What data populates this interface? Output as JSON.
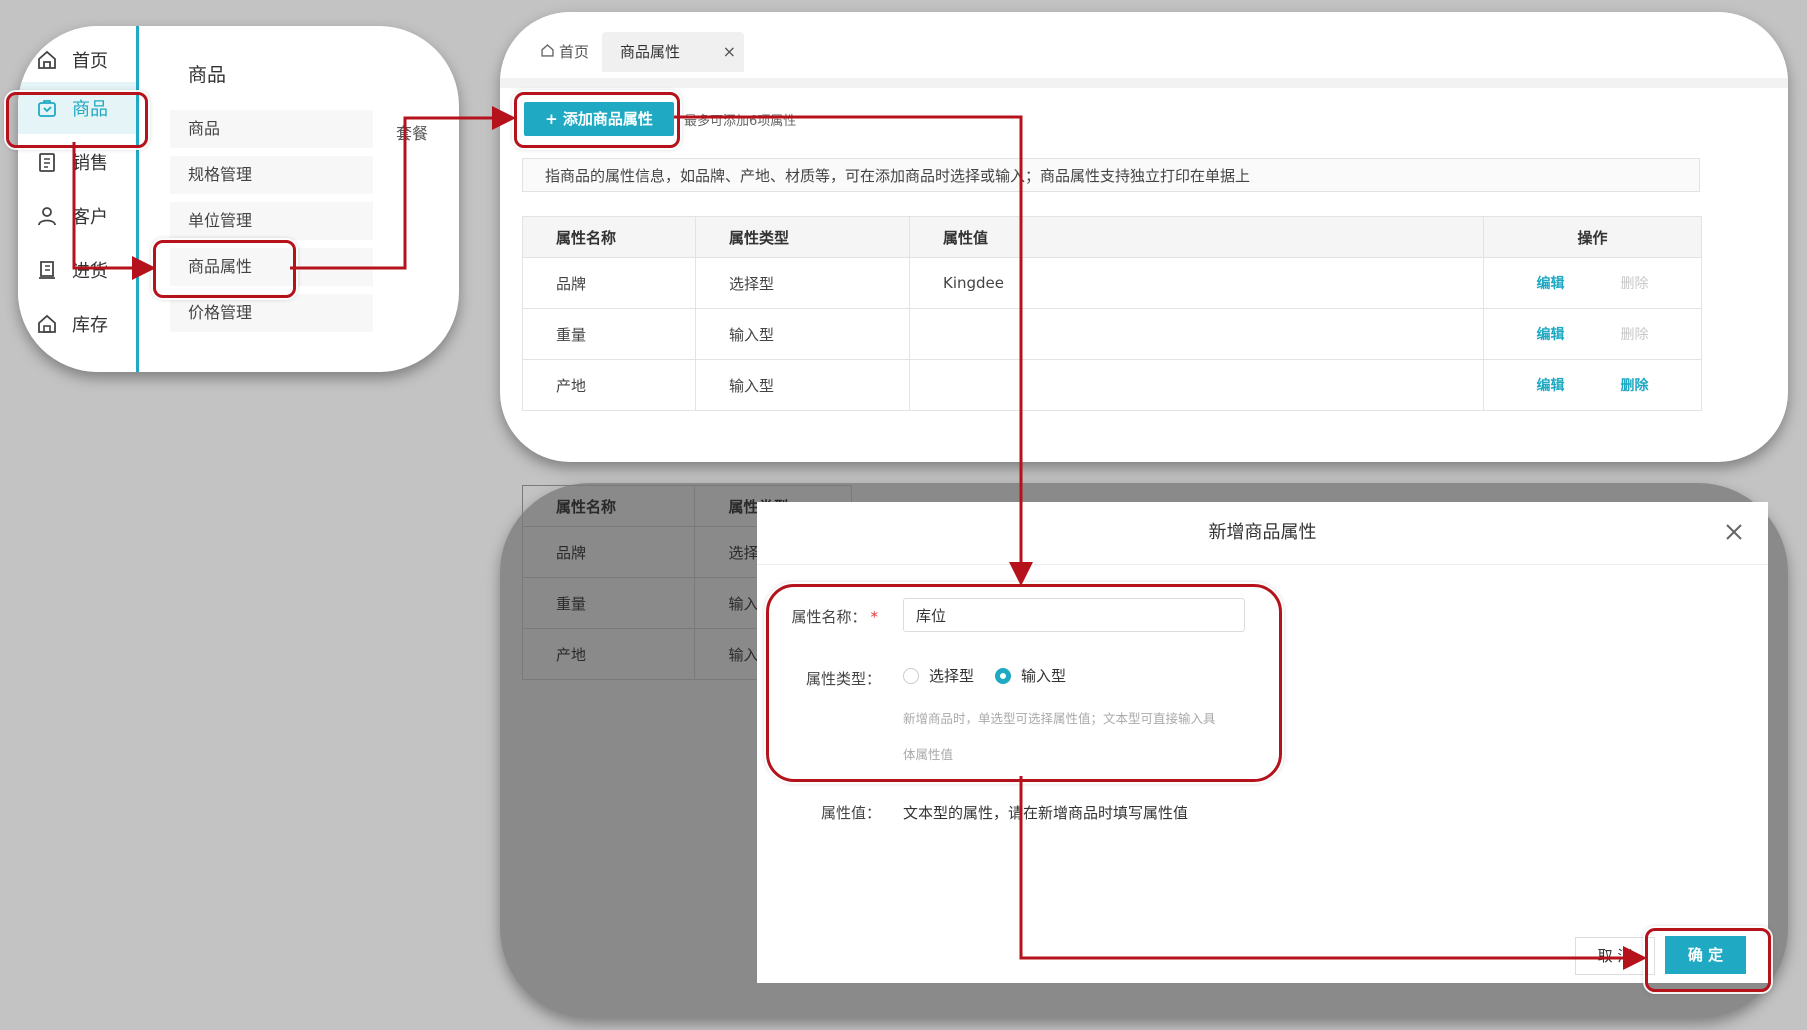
{
  "sidebar": {
    "items": [
      {
        "label": "首页",
        "icon": "home-icon"
      },
      {
        "label": "商品",
        "icon": "goods-icon",
        "active": true
      },
      {
        "label": "销售",
        "icon": "sales-icon"
      },
      {
        "label": "客户",
        "icon": "customer-icon"
      },
      {
        "label": "进货",
        "icon": "purchase-icon"
      },
      {
        "label": "库存",
        "icon": "inventory-icon"
      }
    ]
  },
  "submenu": {
    "title": "商品",
    "items": [
      "商品",
      "规格管理",
      "单位管理",
      "商品属性",
      "价格管理"
    ],
    "extra": "套餐"
  },
  "tabs": {
    "home": "首页",
    "active": "商品属性"
  },
  "toolbar": {
    "add_label": "+ 添加商品属性",
    "limit_text": "最多可添加6项属性"
  },
  "notice": "指商品的属性信息，如品牌、产地、材质等，可在添加商品时选择或输入；商品属性支持独立打印在单据上",
  "table": {
    "headers": [
      "属性名称",
      "属性类型",
      "属性值",
      "操作"
    ],
    "rows": [
      {
        "name": "品牌",
        "type": "选择型",
        "value": "Kingdee",
        "edit": "编辑",
        "delete": "删除",
        "delete_enabled": false
      },
      {
        "name": "重量",
        "type": "输入型",
        "value": "",
        "edit": "编辑",
        "delete": "删除",
        "delete_enabled": false
      },
      {
        "name": "产地",
        "type": "输入型",
        "value": "",
        "edit": "编辑",
        "delete": "删除",
        "delete_enabled": true
      }
    ]
  },
  "dialog": {
    "title": "新增商品属性",
    "name_label": "属性名称：",
    "name_value": "库位",
    "type_label": "属性类型：",
    "type_options": [
      "选择型",
      "输入型"
    ],
    "type_selected": "输入型",
    "hint_line1": "新增商品时，单选型可选择属性值；文本型可直接输入具",
    "hint_line2": "体属性值",
    "value_label": "属性值：",
    "value_text": "文本型的属性，请在新增商品时填写属性值",
    "cancel_label": "取 消",
    "ok_label": "确 定"
  },
  "colors": {
    "accent": "#20a9c3",
    "callout": "#b5121b",
    "background": "#c3c3c3"
  }
}
